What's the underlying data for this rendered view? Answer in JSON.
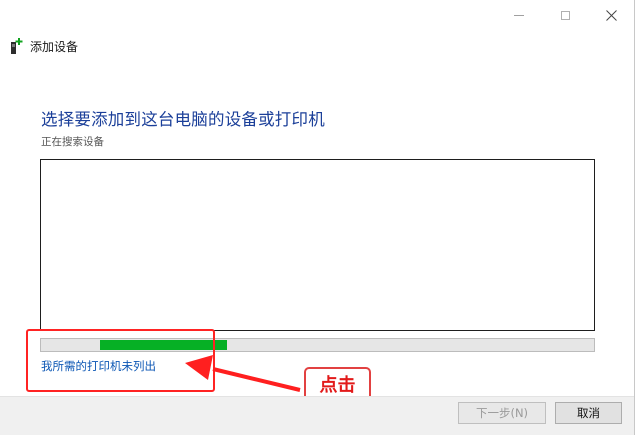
{
  "window": {
    "title": "添加设备"
  },
  "main": {
    "heading": "选择要添加到这台电脑的设备或打印机",
    "status": "正在搜索设备",
    "progress_fraction_start": 0.106,
    "progress_fraction_end": 0.336,
    "printer_link": "我所需的打印机未列出"
  },
  "annotation": {
    "label": "点击",
    "color": "#ff2323"
  },
  "footer": {
    "next_label": "下一步(N)",
    "cancel_label": "取消"
  },
  "colors": {
    "heading": "#1b3f99",
    "link": "#0b56b4",
    "progress": "#06b025"
  },
  "icons": {
    "minimize": "minimize-icon",
    "maximize": "maximize-icon",
    "close": "close-icon",
    "add_device": "add-device-icon"
  }
}
